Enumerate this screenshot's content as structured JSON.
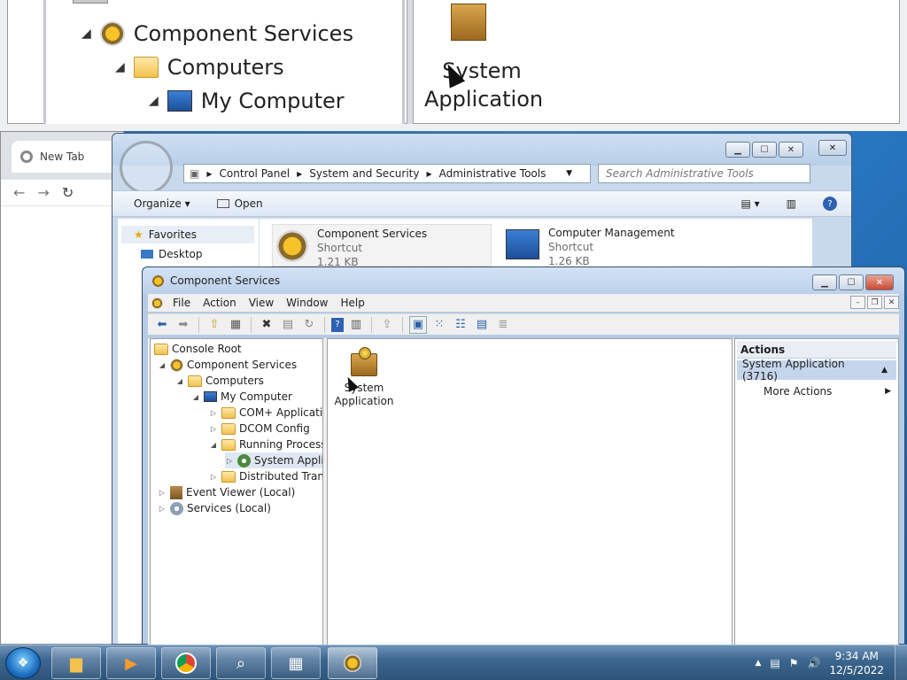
{
  "magnifier": {
    "tree": [
      {
        "label": "Component Services"
      },
      {
        "label": "Computers"
      },
      {
        "label": "My Computer"
      }
    ],
    "result_label_line1": "System",
    "result_label_line2": "Application"
  },
  "chrome": {
    "tab_title": "New Tab"
  },
  "explorer": {
    "breadcrumb": [
      "Control Panel",
      "System and Security",
      "Administrative Tools"
    ],
    "search_placeholder": "Search Administrative Tools",
    "commands": {
      "organize": "Organize",
      "open": "Open"
    },
    "nav": {
      "favorites": "Favorites",
      "desktop": "Desktop"
    },
    "items": [
      {
        "name": "Component Services",
        "type": "Shortcut",
        "size": "1.21 KB"
      },
      {
        "name": "Computer Management",
        "type": "Shortcut",
        "size": "1.26 KB"
      }
    ]
  },
  "mmc": {
    "title": "Component Services",
    "menu": [
      "File",
      "Action",
      "View",
      "Window",
      "Help"
    ],
    "tree": [
      {
        "label": "Console Root"
      },
      {
        "label": "Component Services"
      },
      {
        "label": "Computers"
      },
      {
        "label": "My Computer"
      },
      {
        "label": "COM+ Applications"
      },
      {
        "label": "DCOM Config"
      },
      {
        "label": "Running Processes"
      },
      {
        "label": "System Application"
      },
      {
        "label": "Distributed Transaction Coordinator"
      },
      {
        "label": "Event Viewer (Local)"
      },
      {
        "label": "Services (Local)"
      }
    ],
    "result_item_line1": "System",
    "result_item_line2": "Application",
    "actions": {
      "header": "Actions",
      "selected": "System Application (3716)",
      "more": "More Actions"
    }
  },
  "taskbar": {
    "time": "9:34 AM",
    "date": "12/5/2022"
  }
}
